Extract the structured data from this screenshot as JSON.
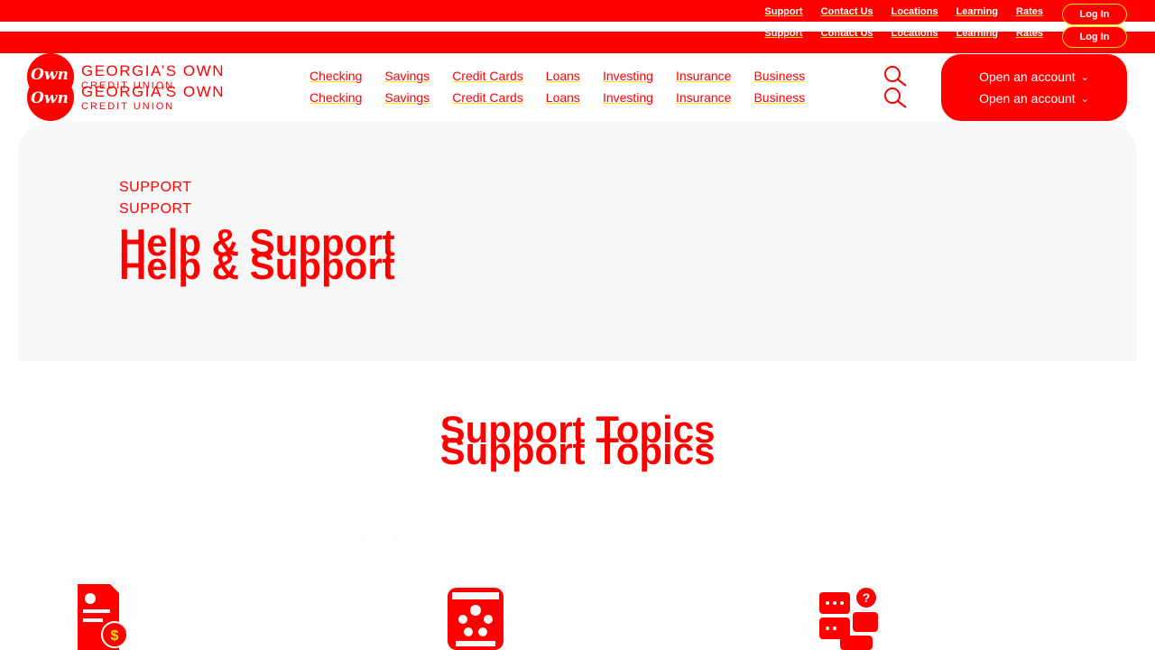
{
  "utility_nav": {
    "links": [
      "Support",
      "Contact Us",
      "Locations",
      "Learning",
      "Rates"
    ],
    "login_label": "Log In"
  },
  "brand": {
    "script": "Own",
    "name": "GEORGIA’S OWN",
    "subname": "CREDIT UNION"
  },
  "main_nav": {
    "items": [
      "Checking",
      "Savings",
      "Credit Cards",
      "Loans",
      "Investing",
      "Insurance",
      "Business"
    ],
    "open_account_label": "Open an account"
  },
  "hero": {
    "eyebrow": "SUPPORT",
    "title": "Help & Support"
  },
  "section": {
    "title": "Support Topics"
  },
  "colors": {
    "brand_red": "#ff0000",
    "accent_yellow": "#ffe600",
    "hero_bg": "#f7f7f7"
  },
  "icons": [
    "search-icon",
    "chevron-down-icon",
    "document-dollar-icon",
    "people-network-icon",
    "chat-question-icon"
  ]
}
